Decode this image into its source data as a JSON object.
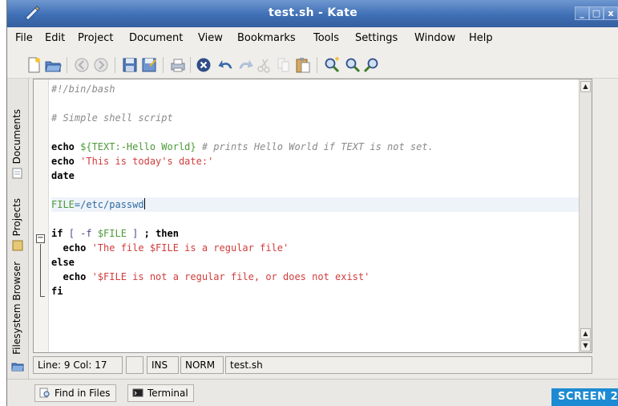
{
  "window": {
    "title": "test.sh - Kate"
  },
  "menu": [
    "File",
    "Edit",
    "Project",
    "Document",
    "View",
    "Bookmarks",
    "Tools",
    "Settings",
    "Window",
    "Help"
  ],
  "toolbar_icons": [
    "new-file-icon",
    "open-file-icon",
    "back-icon",
    "forward-icon",
    "save-icon",
    "save-as-icon",
    "print-icon",
    "close-icon",
    "undo-icon",
    "redo-icon",
    "cut-icon",
    "copy-icon",
    "paste-icon",
    "find-icon",
    "find-next-icon",
    "find-prev-icon"
  ],
  "sidebar_tabs": [
    "Documents",
    "Projects",
    "Filesystem Browser"
  ],
  "code_lines": [
    "#!/bin/bash",
    "",
    "# Simple shell script",
    "",
    "echo ${TEXT:-Hello World} # prints Hello World if TEXT is not set.",
    "echo 'This is today's date:'",
    "date",
    "",
    "FILE=/etc/passwd",
    "",
    "if [ -f $FILE ] ; then",
    "echo 'The file $FILE is a regular file'",
    "else",
    "echo '$FILE is not a regular file, or does not exist'",
    "fi"
  ],
  "status": {
    "position": "Line: 9 Col: 17",
    "blank": "",
    "ins": "INS",
    "norm": "NORM",
    "filename": "test.sh"
  },
  "bottom_tabs": [
    "Find in Files",
    "Terminal"
  ],
  "badge": "SCREEN 2"
}
